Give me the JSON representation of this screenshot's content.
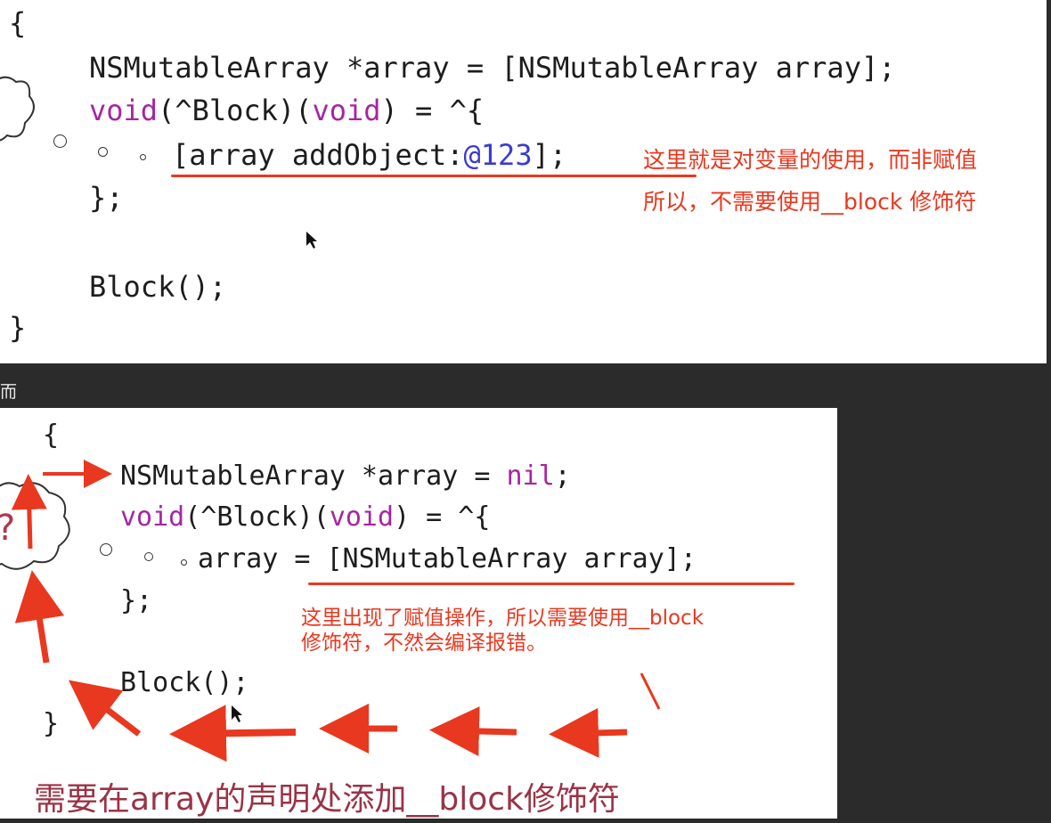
{
  "top_panel": {
    "lines": [
      "{",
      "NSMutableArray *array = [NSMutableArray array];",
      "void(^Block)(void) = ^{",
      "[array addObject:@123];",
      "};",
      "Block();",
      "}"
    ],
    "keyword": "void",
    "number_literal": "@123",
    "note_line1": "这里就是对变量的使用，而非赋值",
    "note_line2": "所以，不需要使用__block 修饰符"
  },
  "divider": {
    "text": "而"
  },
  "bottom_panel": {
    "lines": [
      "{",
      "NSMutableArray *array = nil;",
      "void(^Block)(void) = ^{",
      "array = [NSMutableArray array];",
      "};",
      "Block();",
      "}"
    ],
    "nil_keyword": "nil",
    "note_line1": "这里出现了赋值操作，所以需要使用__block",
    "note_line2": "修饰符，不然会编译报错。",
    "cloud_mark": "?",
    "banner": "需要在array的声明处添加__block修饰符"
  },
  "colors": {
    "annotation": "#e8381f",
    "keyword": "#a526a0",
    "number": "#3a3bd0",
    "banner": "#9a3346",
    "background": "#2b2b2b"
  },
  "icons": [
    "thought-cloud-icon",
    "mouse-cursor-icon",
    "red-arrow-icon"
  ]
}
